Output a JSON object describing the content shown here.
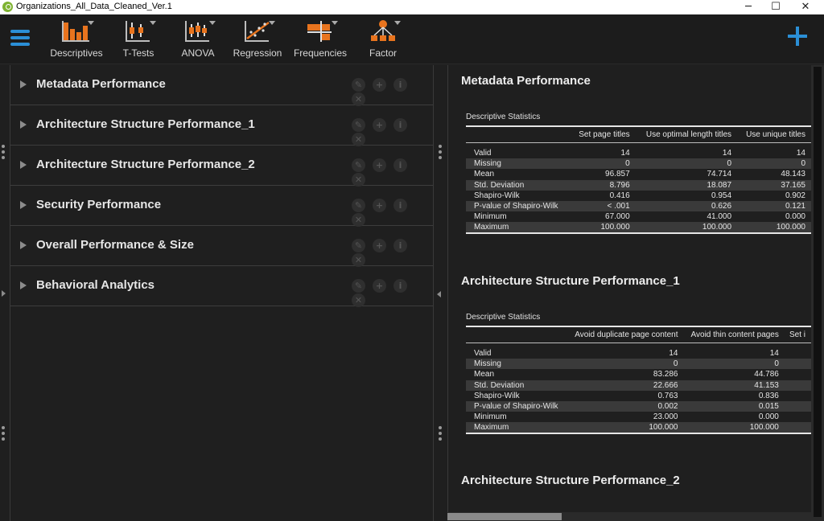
{
  "window": {
    "title": "Organizations_All_Data_Cleaned_Ver.1",
    "minimize": "─",
    "maximize": "☐",
    "close": "✕"
  },
  "ribbon": {
    "tools": [
      {
        "label": "Descriptives",
        "icon": "descriptives-icon"
      },
      {
        "label": "T-Tests",
        "icon": "t-tests-icon"
      },
      {
        "label": "ANOVA",
        "icon": "anova-icon"
      },
      {
        "label": "Regression",
        "icon": "regression-icon"
      },
      {
        "label": "Frequencies",
        "icon": "frequencies-icon"
      },
      {
        "label": "Factor",
        "icon": "factor-icon"
      }
    ],
    "accent_color": "#2b8fd6",
    "icon_color": "#e8741e"
  },
  "analyses": [
    {
      "name": "Metadata Performance"
    },
    {
      "name": "Architecture Structure Performance_1"
    },
    {
      "name": "Architecture Structure Performance_2"
    },
    {
      "name": "Security Performance"
    },
    {
      "name": "Overall Performance & Size"
    },
    {
      "name": "Behavioral Analytics"
    }
  ],
  "analysis_actions": {
    "edit": "✎",
    "duplicate": "+",
    "info": "i",
    "remove": "✕"
  },
  "results": [
    {
      "title": "Metadata Performance",
      "table_caption": "Descriptive Statistics",
      "columns": [
        "",
        "Set page titles",
        "Use optimal length titles",
        "Use unique titles"
      ],
      "rows": [
        [
          "Valid",
          "14",
          "14",
          "14"
        ],
        [
          "Missing",
          "0",
          "0",
          "0"
        ],
        [
          "Mean",
          "96.857",
          "74.714",
          "48.143"
        ],
        [
          "Std. Deviation",
          "8.796",
          "18.087",
          "37.165"
        ],
        [
          "Shapiro-Wilk",
          "0.416",
          "0.954",
          "0.902"
        ],
        [
          "P-value of Shapiro-Wilk",
          "< .001",
          "0.626",
          "0.121"
        ],
        [
          "Minimum",
          "67.000",
          "41.000",
          "0.000"
        ],
        [
          "Maximum",
          "100.000",
          "100.000",
          "100.000"
        ]
      ]
    },
    {
      "title": "Architecture Structure Performance_1",
      "table_caption": "Descriptive Statistics",
      "columns": [
        "",
        "Avoid duplicate page content",
        "Avoid thin content pages",
        "Set i"
      ],
      "rows": [
        [
          "Valid",
          "14",
          "14",
          ""
        ],
        [
          "Missing",
          "0",
          "0",
          ""
        ],
        [
          "Mean",
          "83.286",
          "44.786",
          ""
        ],
        [
          "Std. Deviation",
          "22.666",
          "41.153",
          ""
        ],
        [
          "Shapiro-Wilk",
          "0.763",
          "0.836",
          ""
        ],
        [
          "P-value of Shapiro-Wilk",
          "0.002",
          "0.015",
          ""
        ],
        [
          "Minimum",
          "23.000",
          "0.000",
          ""
        ],
        [
          "Maximum",
          "100.000",
          "100.000",
          ""
        ]
      ]
    },
    {
      "title": "Architecture Structure Performance_2"
    }
  ]
}
